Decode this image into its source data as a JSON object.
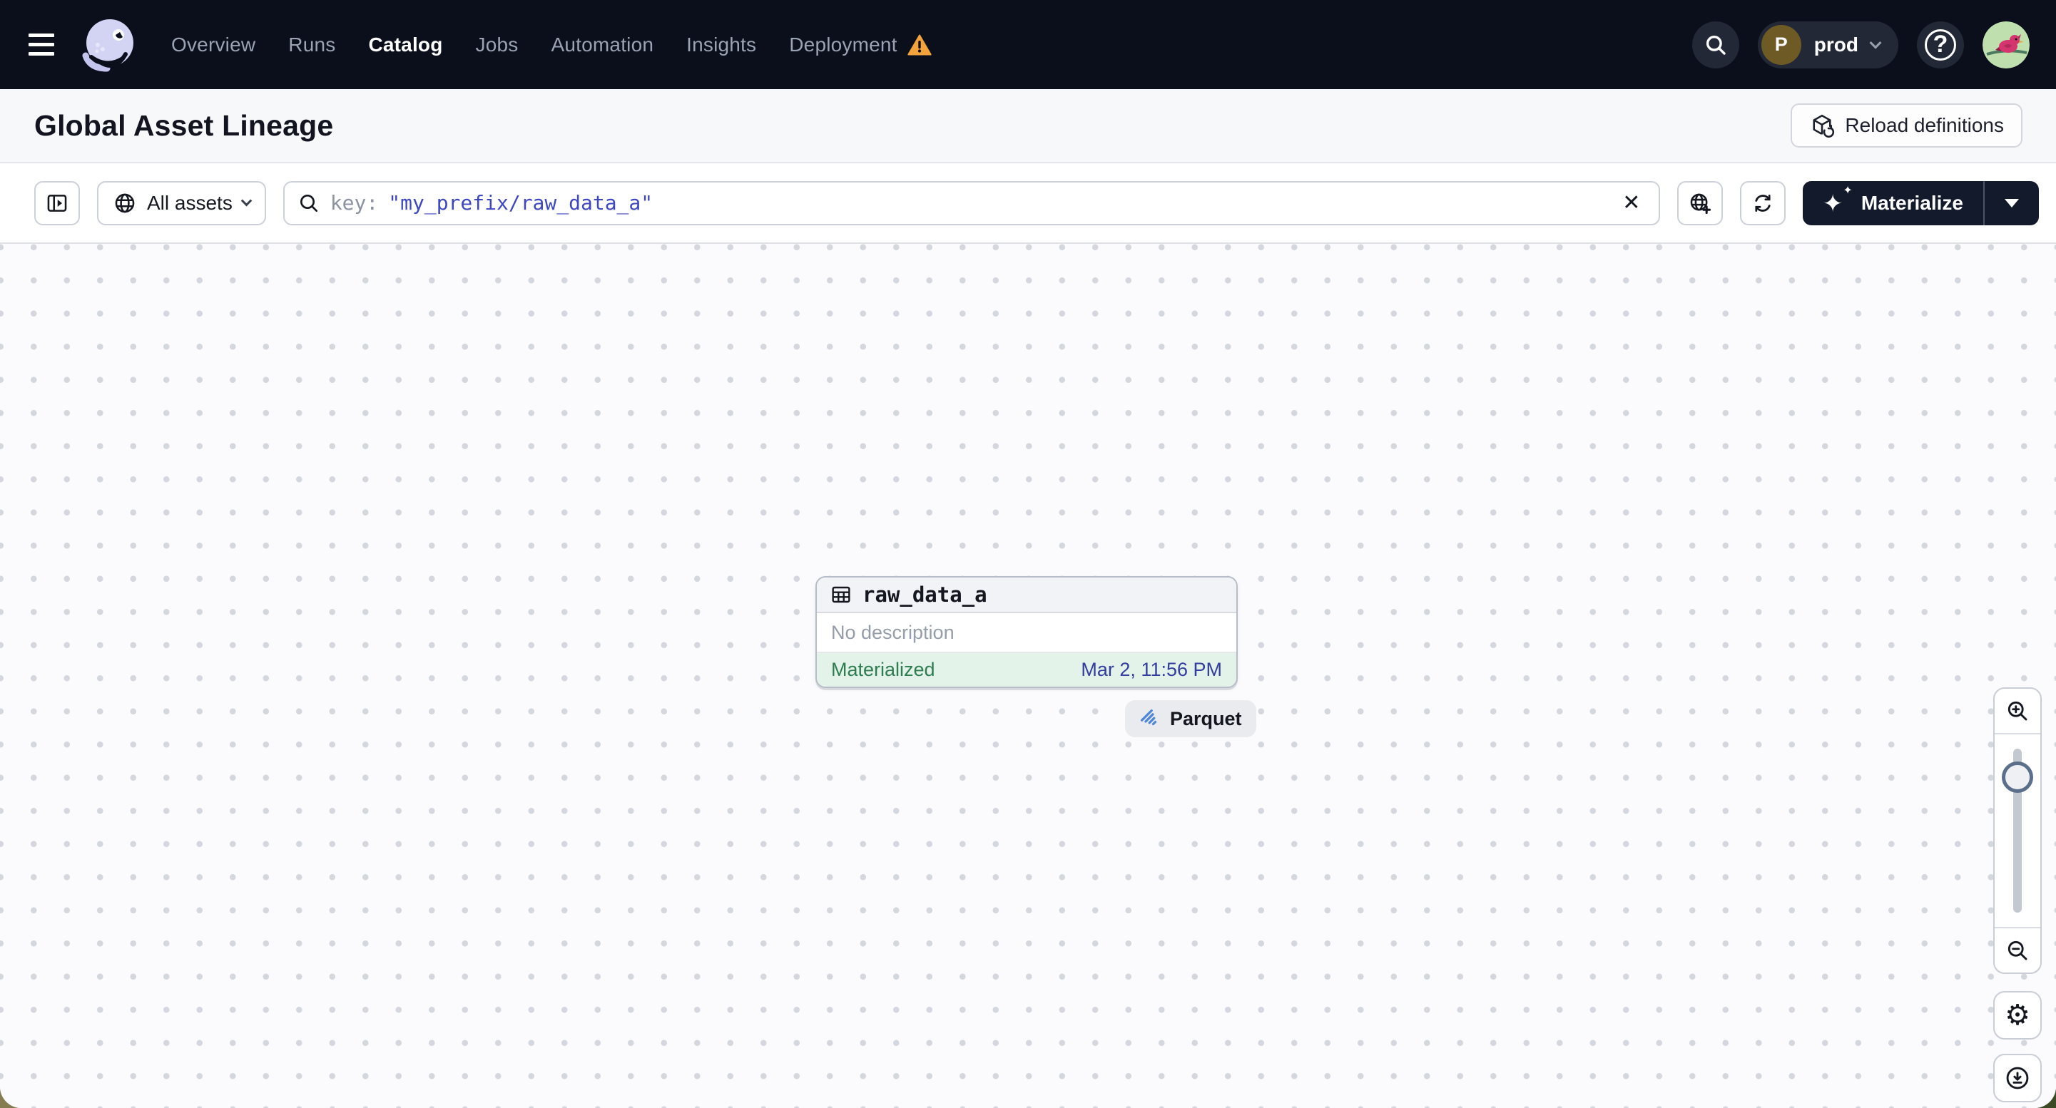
{
  "nav": {
    "items": [
      {
        "label": "Overview",
        "active": false
      },
      {
        "label": "Runs",
        "active": false
      },
      {
        "label": "Catalog",
        "active": true
      },
      {
        "label": "Jobs",
        "active": false
      },
      {
        "label": "Automation",
        "active": false
      },
      {
        "label": "Insights",
        "active": false
      },
      {
        "label": "Deployment",
        "active": false,
        "warning": true
      }
    ],
    "deployment_switcher": {
      "label": "prod",
      "initial": "P"
    },
    "help_glyph": "?"
  },
  "header": {
    "title": "Global Asset Lineage",
    "reload_label": "Reload definitions"
  },
  "toolbar": {
    "scope_label": "All assets",
    "search": {
      "prefix": "key:",
      "value": "\"my_prefix/raw_data_a\""
    },
    "materialize_label": "Materialize"
  },
  "canvas": {
    "node": {
      "name": "raw_data_a",
      "description": "No description",
      "status": "Materialized",
      "status_time": "Mar 2, 11:56 PM",
      "tag": "Parquet"
    }
  },
  "icons": {
    "sparkle": "✦",
    "close": "✕",
    "gear": "⚙"
  },
  "colors": {
    "nav_bg": "#0b0e1b",
    "status_green": "#2e7d50",
    "status_green_bg": "#e3f3e9",
    "timestamp_blue": "#333da0",
    "query_blue": "#3e47c2",
    "warning_orange": "#f2a33c",
    "parquet_blue": "#4e86d8"
  }
}
